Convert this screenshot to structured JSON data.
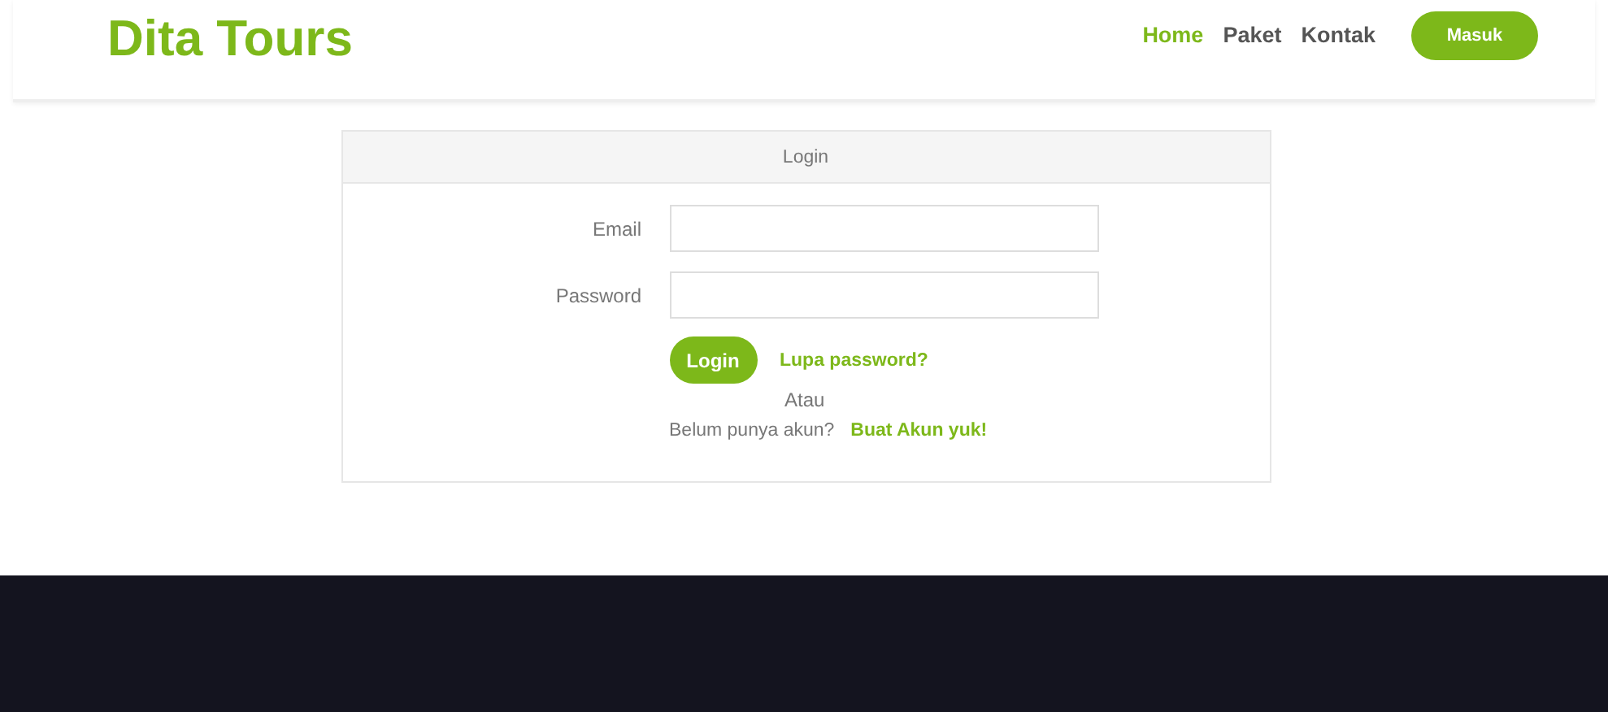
{
  "brand": "Dita Tours",
  "nav": [
    {
      "label": "Home",
      "selected": true
    },
    {
      "label": "Paket",
      "selected": false
    },
    {
      "label": "Kontak",
      "selected": false
    }
  ],
  "nav_button": "Masuk",
  "login_card": {
    "title": "Login",
    "fields": [
      {
        "label": "Email"
      },
      {
        "label": "Password"
      }
    ],
    "submit": "Login",
    "forgot_link": "Lupa password?",
    "separator": "Atau",
    "signup_prompt": "Belum punya akun?",
    "signup_link": "Buat Akun yuk!"
  }
}
